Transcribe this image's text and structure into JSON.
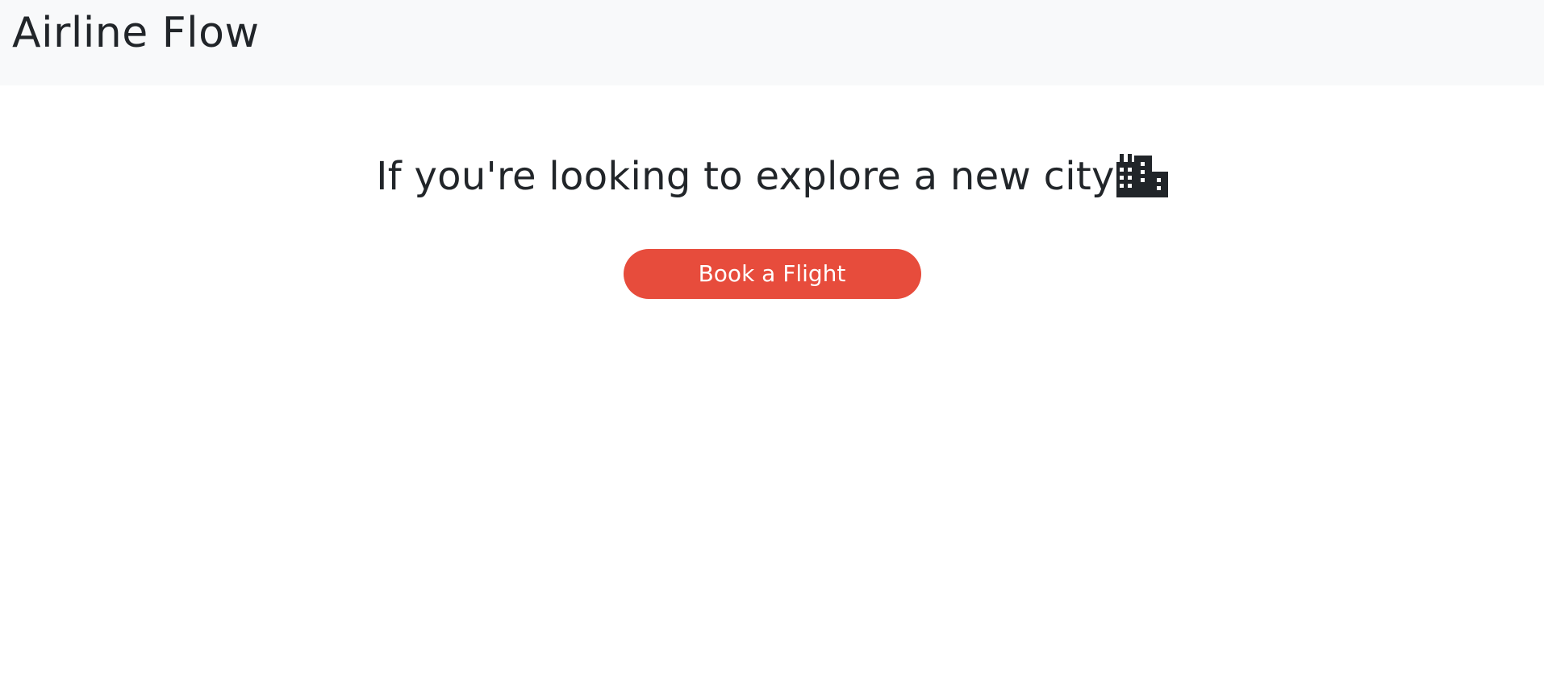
{
  "navbar": {
    "brand": "Airline Flow"
  },
  "hero": {
    "headline": "If you're looking to explore a new city",
    "icon": "city-icon",
    "button_label": "Book a Flight"
  },
  "colors": {
    "navbar_bg": "#f8f9fa",
    "text": "#212529",
    "accent": "#e74c3c",
    "button_text": "#ffffff"
  }
}
